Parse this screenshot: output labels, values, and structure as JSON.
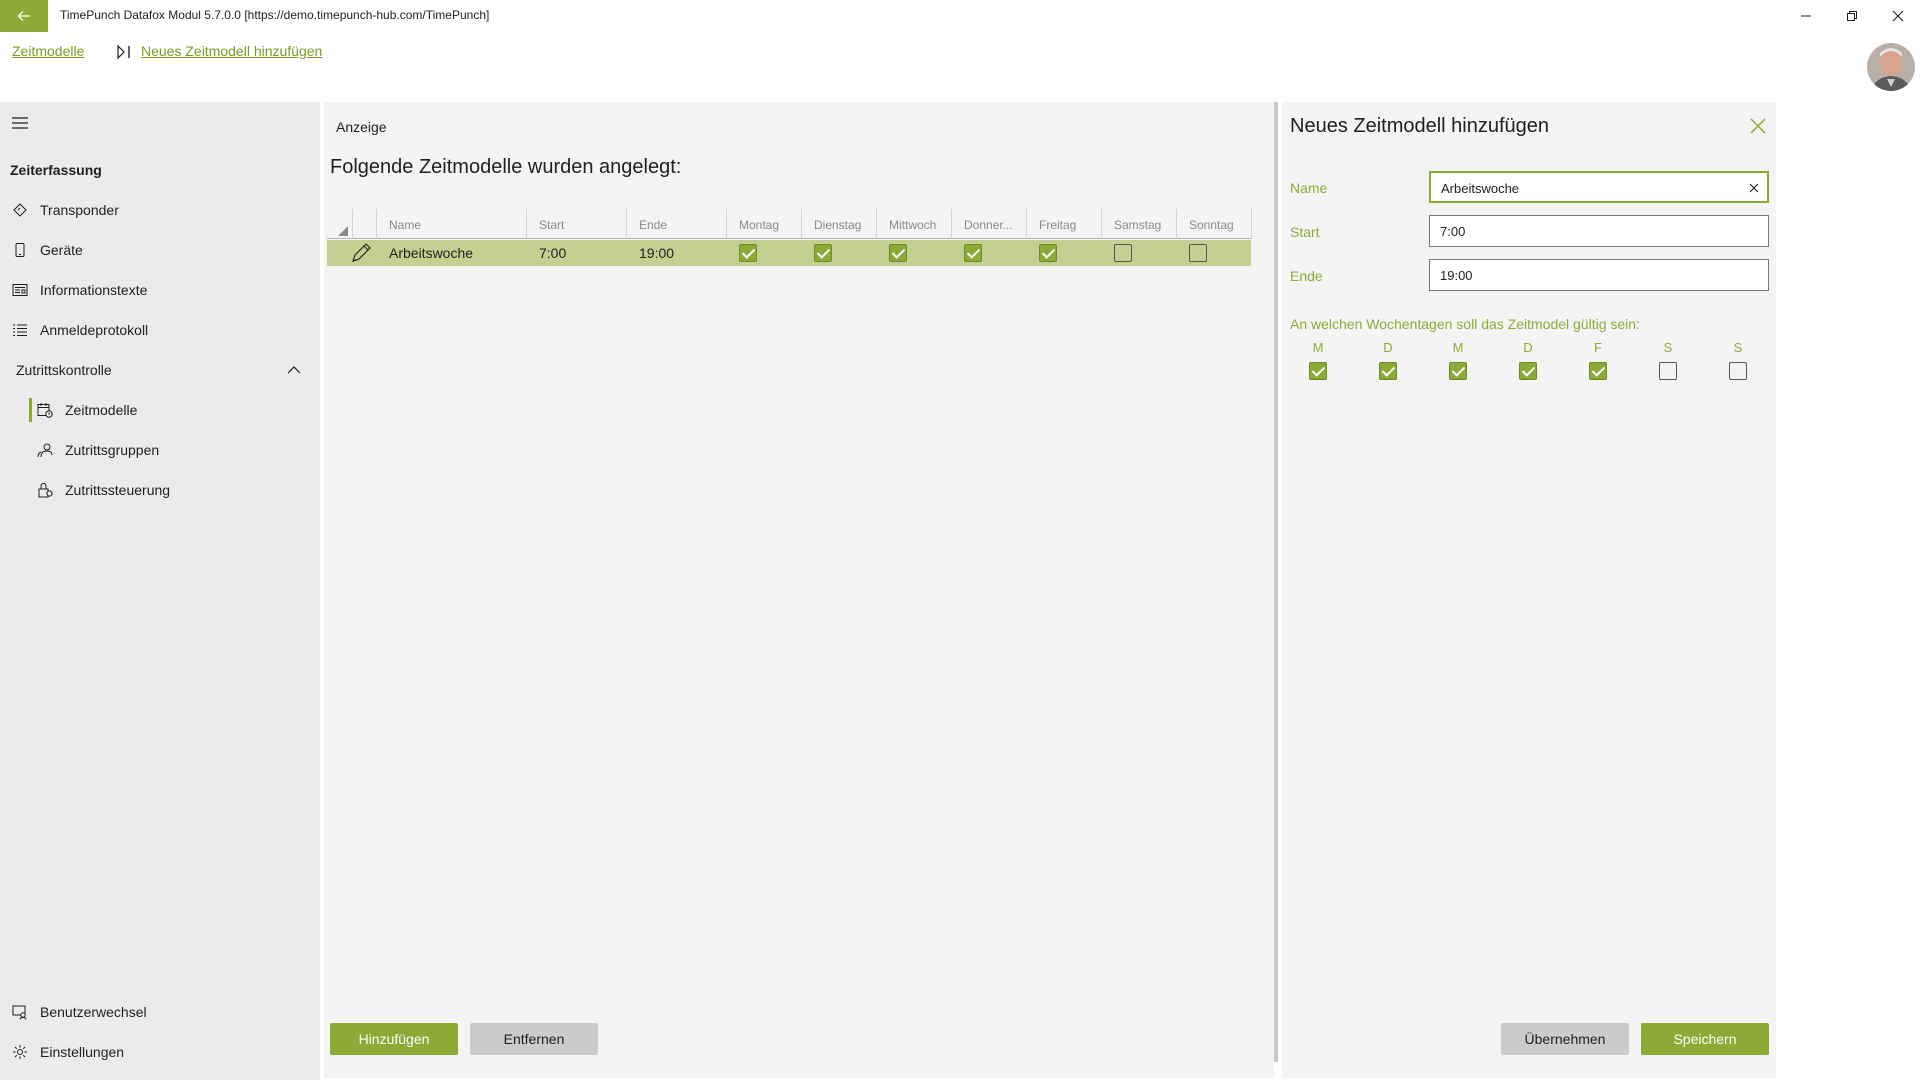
{
  "app": {
    "title": "TimePunch Datafox Modul 5.7.0.0 [https://demo.timepunch-hub.com/TimePunch]"
  },
  "colors": {
    "accent": "#8cab36",
    "selected_row": "#c3d092",
    "sidebar_bg": "#ebebeb",
    "panel_bg": "#f4f4f4"
  },
  "breadcrumb": {
    "root": "Zeitmodelle",
    "current": "Neues Zeitmodell hinzufügen"
  },
  "sidebar": {
    "heading": "Zeiterfassung",
    "items": [
      {
        "label": "Transponder",
        "icon": "transponder-icon"
      },
      {
        "label": "Geräte",
        "icon": "device-icon"
      },
      {
        "label": "Informationstexte",
        "icon": "info-text-icon"
      },
      {
        "label": "Anmeldeprotokoll",
        "icon": "list-icon"
      }
    ],
    "group": {
      "label": "Zutrittskontrolle",
      "icon": "chevron-up-icon",
      "items": [
        {
          "label": "Zeitmodelle",
          "icon": "calendar-icon",
          "selected": true
        },
        {
          "label": "Zutrittsgruppen",
          "icon": "group-icon"
        },
        {
          "label": "Zutrittssteuerung",
          "icon": "lock-icon"
        }
      ]
    },
    "bottom": [
      {
        "label": "Benutzerwechsel",
        "icon": "switch-user-icon"
      },
      {
        "label": "Einstellungen",
        "icon": "gear-icon"
      }
    ]
  },
  "main": {
    "section_label": "Anzeige",
    "heading": "Folgende Zeitmodelle wurden angelegt:",
    "columns": [
      "Name",
      "Start",
      "Ende",
      "Montag",
      "Dienstag",
      "Mittwoch",
      "Donner...",
      "Freitag",
      "Samstag",
      "Sonntag"
    ],
    "rows": [
      {
        "name": "Arbeitswoche",
        "start": "7:00",
        "end": "19:00",
        "days": [
          true,
          true,
          true,
          true,
          true,
          false,
          false
        ]
      }
    ],
    "add_button": "Hinzufügen",
    "remove_button": "Entfernen"
  },
  "panel": {
    "title": "Neues Zeitmodell hinzufügen",
    "name_label": "Name",
    "name_value": "Arbeitswoche",
    "start_label": "Start",
    "start_value": "7:00",
    "end_label": "Ende",
    "end_value": "19:00",
    "weekday_question": "An welchen Wochentagen soll das Zeitmodel gültig sein:",
    "weekdays": [
      {
        "letter": "M",
        "checked": true
      },
      {
        "letter": "D",
        "checked": true
      },
      {
        "letter": "M",
        "checked": true
      },
      {
        "letter": "D",
        "checked": true
      },
      {
        "letter": "F",
        "checked": true
      },
      {
        "letter": "S",
        "checked": false
      },
      {
        "letter": "S",
        "checked": false
      }
    ],
    "apply_button": "Übernehmen",
    "save_button": "Speichern"
  }
}
